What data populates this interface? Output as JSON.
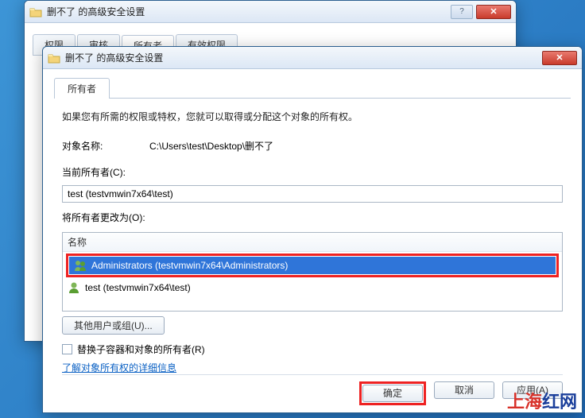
{
  "backWindow": {
    "title": "删不了 的高级安全设置",
    "tabs": [
      "权限",
      "审核",
      "所有者",
      "有效权限"
    ],
    "activeTab": 2
  },
  "frontWindow": {
    "title": "删不了 的高级安全设置",
    "subTab": "所有者",
    "intro": "如果您有所需的权限或特权，您就可以取得或分配这个对象的所有权。",
    "objectNameLabel": "对象名称:",
    "objectNameValue": "C:\\Users\\test\\Desktop\\删不了",
    "currentOwnerLabel": "当前所有者(C):",
    "currentOwnerValue": "test (testvmwin7x64\\test)",
    "changeOwnerLabel": "将所有者更改为(O):",
    "listHeader": "名称",
    "owners": [
      {
        "name": "Administrators (testvmwin7x64\\Administrators)",
        "selected": true
      },
      {
        "name": "test (testvmwin7x64\\test)",
        "selected": false
      }
    ],
    "otherUsersBtn": "其他用户或组(U)...",
    "replaceCheckbox": "替换子容器和对象的所有者(R)",
    "learnMoreLink": "了解对象所有权的详细信息",
    "buttons": {
      "ok": "确定",
      "cancel": "取消",
      "apply": "应用(A)"
    }
  },
  "watermark": {
    "part1": "上海",
    "part2": "红网"
  }
}
